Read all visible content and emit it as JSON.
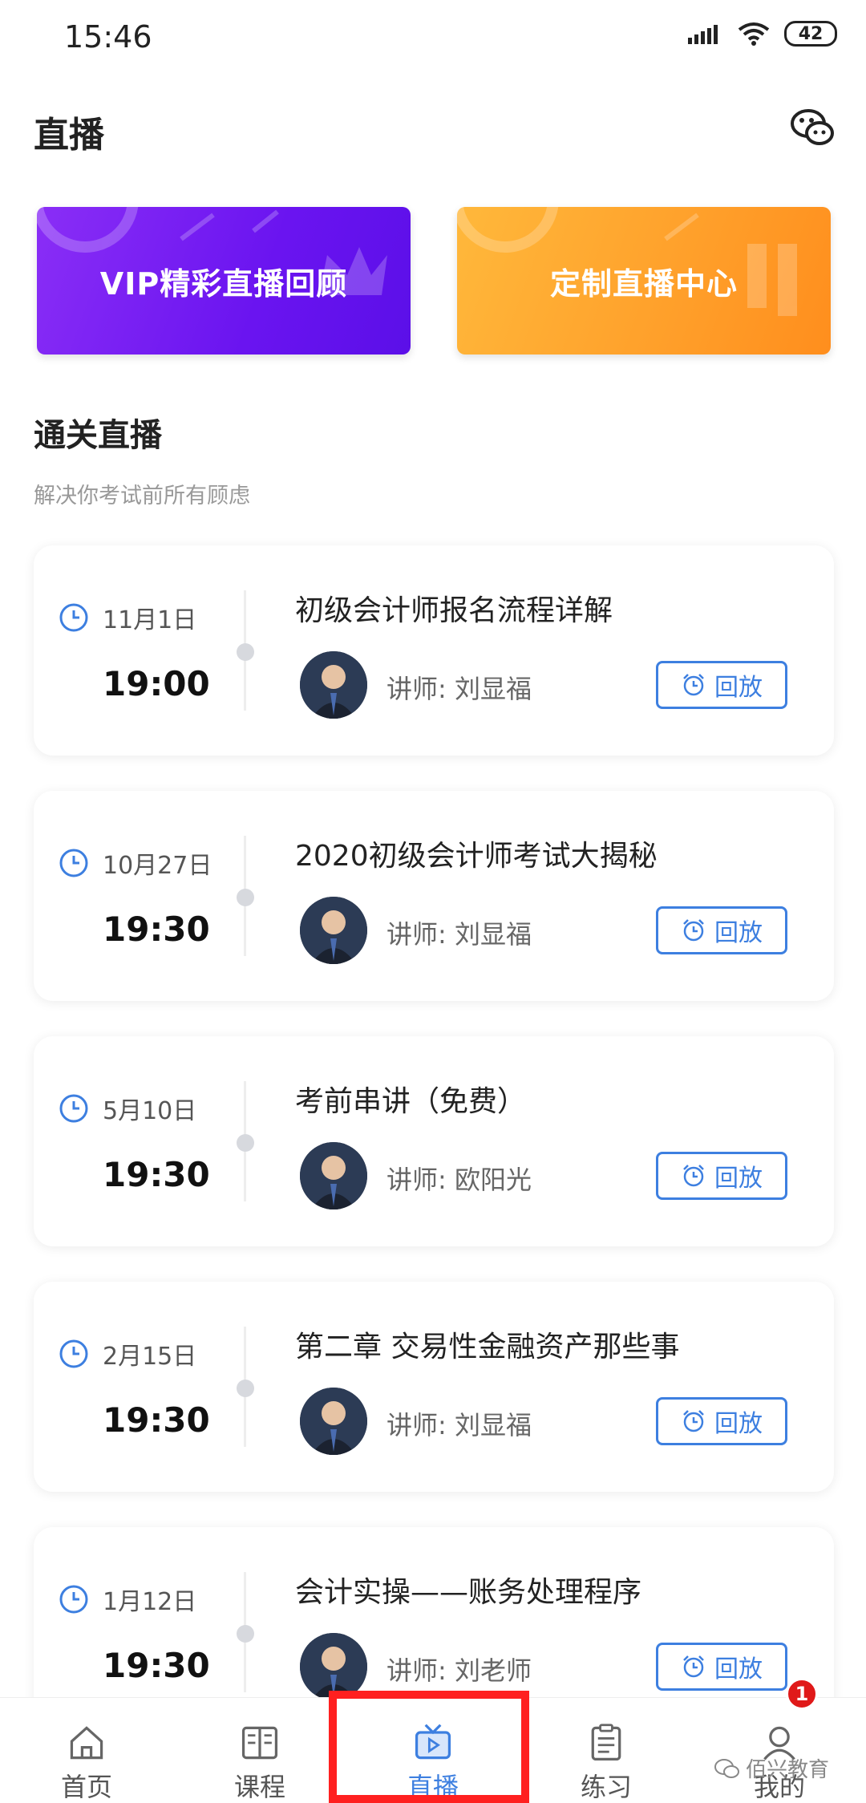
{
  "status_bar": {
    "time": "15:46",
    "battery": "42"
  },
  "header": {
    "title": "直播"
  },
  "banners": {
    "vip": "VIP精彩直播回顾",
    "custom": "定制直播中心"
  },
  "section": {
    "title": "通关直播",
    "subtitle": "解决你考试前所有顾虑"
  },
  "sessions": [
    {
      "date": "11月1日",
      "time": "19:00",
      "title": "初级会计师报名流程详解",
      "teacher": "讲师: 刘显福",
      "button": "回放"
    },
    {
      "date": "10月27日",
      "time": "19:30",
      "title": "2020初级会计师考试大揭秘",
      "teacher": "讲师: 刘显福",
      "button": "回放"
    },
    {
      "date": "5月10日",
      "time": "19:30",
      "title": "考前串讲（免费）",
      "teacher": "讲师: 欧阳光",
      "button": "回放"
    },
    {
      "date": "2月15日",
      "time": "19:30",
      "title": "第二章  交易性金融资产那些事",
      "teacher": "讲师: 刘显福",
      "button": "回放"
    },
    {
      "date": "1月12日",
      "time": "19:30",
      "title": "会计实操——账务处理程序",
      "teacher": "讲师: 刘老师",
      "button": "回放"
    }
  ],
  "tabbar": {
    "items": [
      {
        "label": "首页",
        "icon": "home-icon"
      },
      {
        "label": "课程",
        "icon": "book-icon"
      },
      {
        "label": "直播",
        "icon": "tv-icon"
      },
      {
        "label": "练习",
        "icon": "clipboard-icon"
      },
      {
        "label": "我的",
        "icon": "user-icon"
      }
    ],
    "active_index": 2,
    "badge": "1"
  },
  "watermark": "佰兴教育",
  "colors": {
    "accent": "#3d7fe0",
    "vip_banner": "#6a14f0",
    "custom_banner": "#ff9f2a",
    "highlight": "#ff2020"
  }
}
